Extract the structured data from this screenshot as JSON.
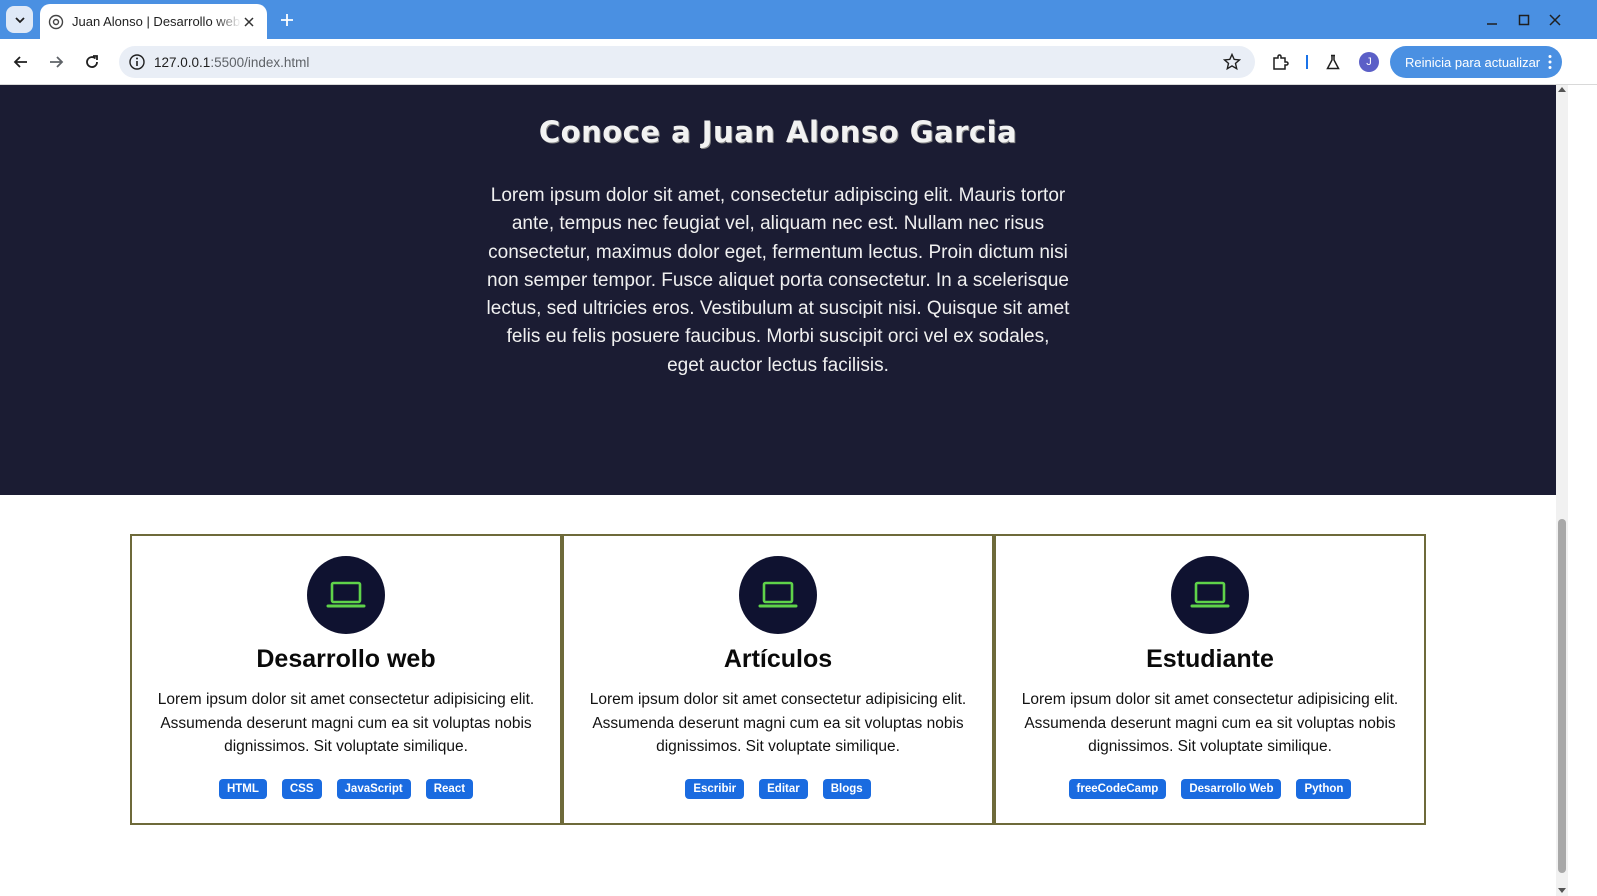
{
  "browser": {
    "tab_title": "Juan Alonso | Desarrollo web",
    "url_host": "127.0.0.1",
    "url_rest": ":5500/index.html",
    "profile_initial": "J",
    "update_label": "Reinicia para actualizar",
    "accent_color": "#4a90e2"
  },
  "hero": {
    "title": "Conoce a Juan Alonso Garcia",
    "text": "Lorem ipsum dolor sit amet, consectetur adipiscing elit. Mauris tortor ante, tempus nec feugiat vel, aliquam nec est. Nullam nec risus consectetur, maximus dolor eget, fermentum lectus. Proin dictum nisi non semper tempor. Fusce aliquet porta consectetur. In a scelerisque lectus, sed ultricies eros. Vestibulum at suscipit nisi. Quisque sit amet felis eu felis posuere faucibus. Morbi suscipit orci vel ex sodales, eget auctor lectus facilisis.",
    "background": "#1b1c33"
  },
  "cards": [
    {
      "icon": "laptop-icon",
      "title": "Desarrollo web",
      "text": "Lorem ipsum dolor sit amet consectetur adipisicing elit. Assumenda deserunt magni cum ea sit voluptas nobis dignissimos. Sit voluptate similique.",
      "tags": [
        "HTML",
        "CSS",
        "JavaScript",
        "React"
      ]
    },
    {
      "icon": "laptop-icon",
      "title": "Artículos",
      "text": "Lorem ipsum dolor sit amet consectetur adipisicing elit. Assumenda deserunt magni cum ea sit voluptas nobis dignissimos. Sit voluptate similique.",
      "tags": [
        "Escribir",
        "Editar",
        "Blogs"
      ]
    },
    {
      "icon": "laptop-icon",
      "title": "Estudiante",
      "text": "Lorem ipsum dolor sit amet consectetur adipisicing elit. Assumenda deserunt magni cum ea sit voluptas nobis dignissimos. Sit voluptate similique.",
      "tags": [
        "freeCodeCamp",
        "Desarrollo Web",
        "Python"
      ]
    }
  ],
  "colors": {
    "icon_green": "#5fd34a",
    "tag_blue": "#1a6be0",
    "card_border": "#6e6a3a"
  }
}
